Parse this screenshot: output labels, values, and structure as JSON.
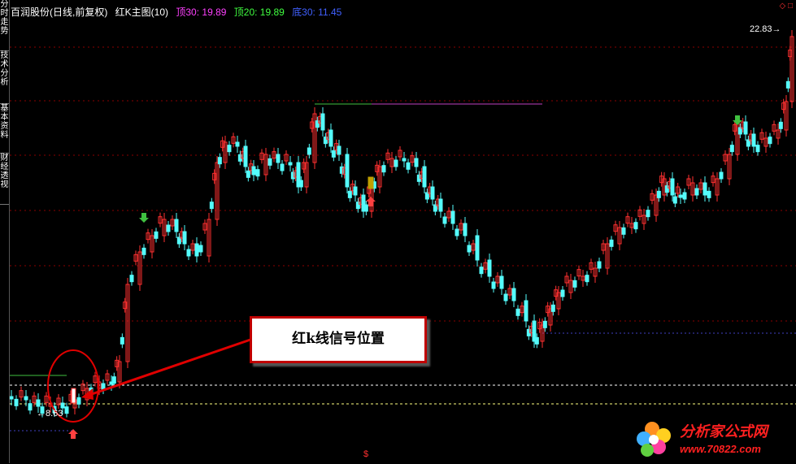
{
  "sidebar": {
    "tabs": [
      {
        "label": "分时走势"
      },
      {
        "label": "技术分析"
      },
      {
        "label": "基本资料"
      },
      {
        "label": "财经透视"
      }
    ]
  },
  "header": {
    "title": "百润股份(日线,前复权)",
    "indicator": "红K主图(10)",
    "top30": "顶30: 19.89",
    "top20": "顶20: 19.89",
    "bottom30": "底30: 11.45"
  },
  "chart": {
    "high_label": "22.83",
    "low_label": "8.63",
    "marker": "$",
    "colors": {
      "up": "#ff3030",
      "down": "#54fcfc",
      "grid": "#8b0000",
      "top30": "#c040c0",
      "top20": "#40c040",
      "bottom30": "#4040c0",
      "white_dash": "#ffffff",
      "yellow_dash": "#ffff80",
      "signal_up_arrow": "#ff4040",
      "signal_down_arrow": "#40c040"
    }
  },
  "callout": {
    "text": "红k线信号位置"
  },
  "watermark": {
    "name": "分析家公式网",
    "url": "www.70822.com"
  },
  "icons": {
    "top_right": "window-toggle-icon"
  }
}
